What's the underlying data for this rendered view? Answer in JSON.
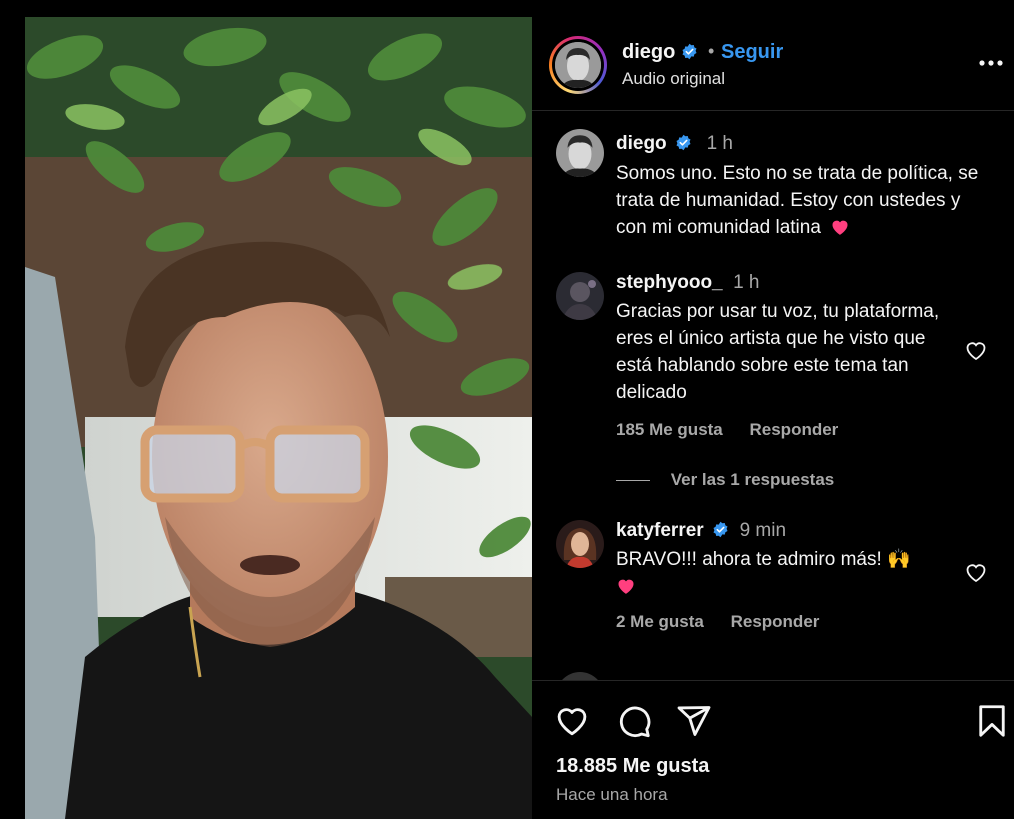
{
  "post": {
    "username": "diego",
    "follow_label": "Seguir",
    "separator": "•",
    "audio_label": "Audio original",
    "likes_count": "18.885",
    "likes_label": "Me gusta",
    "posted_ago": "Hace una hora"
  },
  "comments": [
    {
      "username": "diego",
      "verified": true,
      "time": "1 h",
      "text": "Somos uno. Esto no se trata de política, se trata de humanidad. Estoy con ustedes y con mi comunidad latina",
      "emoji": "heart"
    },
    {
      "username": "stephyooo_",
      "time": "1 h",
      "text": "Gracias por usar tu voz, tu plataforma, eres el único artista que he visto que está hablando sobre este tema tan delicado",
      "likes": "185 Me gusta",
      "reply_label": "Responder",
      "view_replies": "Ver las 1 respuestas"
    },
    {
      "username": "katyferrer",
      "verified": true,
      "time": "9 min",
      "text": "BRAVO!!! ahora te admiro más! 🙌",
      "emoji": "heart",
      "likes": "2 Me gusta",
      "reply_label": "Responder"
    }
  ],
  "icons": {
    "more": "more-options-icon",
    "like": "heart-icon",
    "comment": "comment-icon",
    "share": "share-icon",
    "save": "bookmark-icon",
    "verified": "verified-badge-icon"
  },
  "colors": {
    "accent": "#3897f0",
    "background": "#000000",
    "muted_text": "#a8a8a8",
    "heart_emoji": "#ff3f7f"
  }
}
